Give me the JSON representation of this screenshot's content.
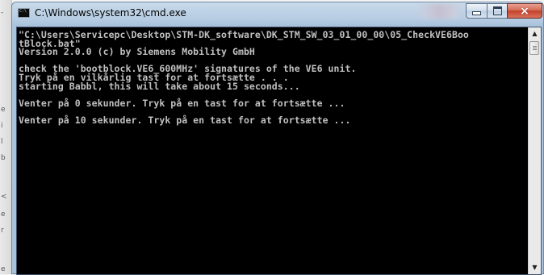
{
  "window": {
    "title": "C:\\Windows\\system32\\cmd.exe",
    "icon": "cmd-icon",
    "icon_label": "C:\\",
    "controls": {
      "minimize": "minimize-icon",
      "maximize": "maximize-icon",
      "close": "×"
    }
  },
  "console": {
    "background": "#000000",
    "foreground": "#c0c0c0",
    "lines": [
      "\"C:\\Users\\Servicepc\\Desktop\\STM-DK_software\\DK_STM_SW_03_01_00_00\\05_CheckVE6Boo",
      "tBlock.bat\"",
      "Version 2.0.0 (c) by Siemens Mobility GmbH",
      "",
      "check the 'bootblock.VE6_600MHz' signatures of the VE6 unit.",
      "Tryk på en vilkårlig tast for at fortsætte . . .",
      "starting Babbl, this will take about 15 seconds...",
      "",
      "Venter på 0 sekunder. Tryk på en tast for at fortsætte ...",
      "",
      "Venter på 10 sekunder. Tryk på en tast for at fortsætte ..."
    ]
  },
  "scrollbar": {
    "up_arrow": "▲",
    "down_arrow": "▼"
  },
  "background_window": {
    "edge_chars": [
      "-",
      "e",
      "i",
      "l",
      "b",
      "",
      "<",
      "e",
      "r",
      "",
      "e"
    ]
  }
}
